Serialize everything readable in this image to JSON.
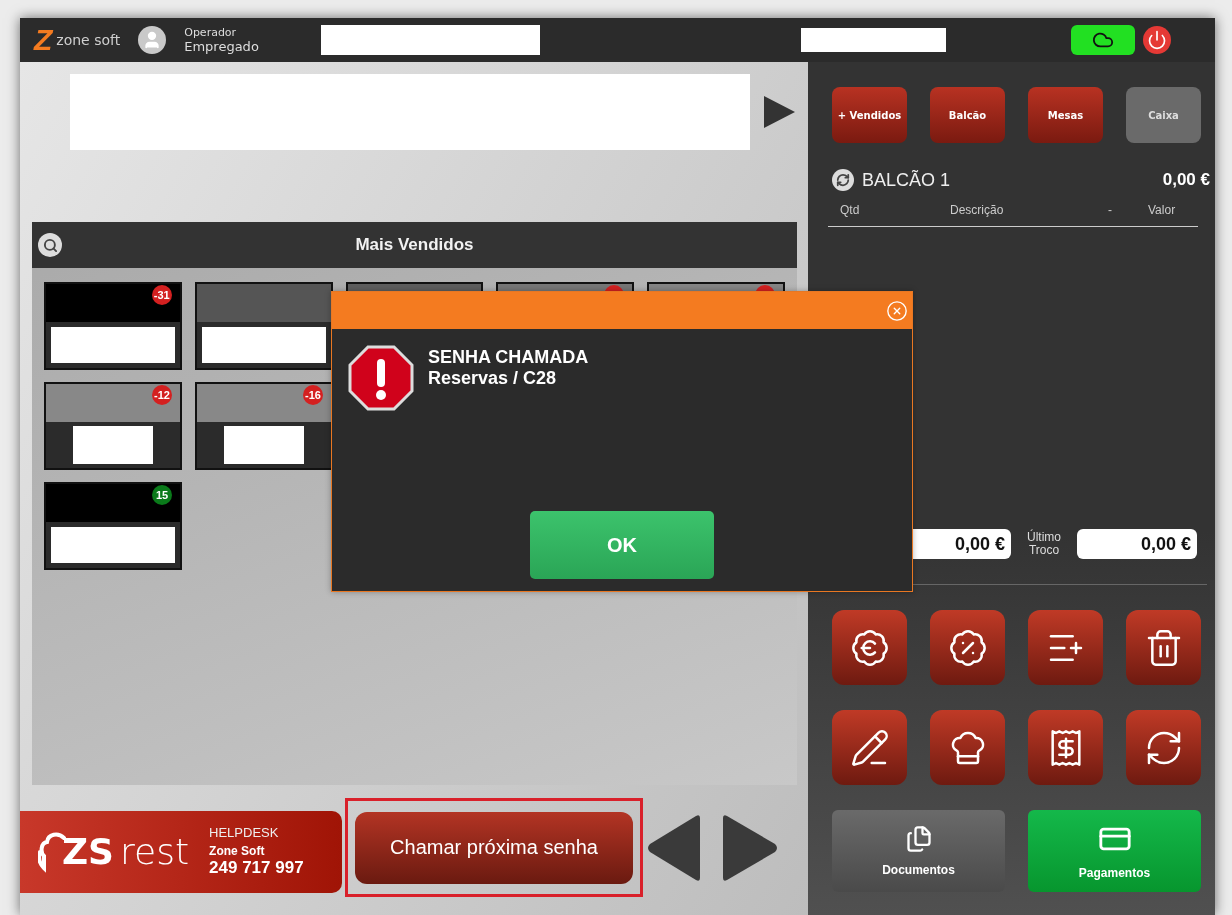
{
  "header": {
    "logo": {
      "mark": "Z",
      "name": "zone soft"
    },
    "operator": {
      "role": "Operador",
      "name": "Empregado"
    },
    "sync": {
      "online": true
    }
  },
  "products": {
    "title": "Mais Vendidos",
    "rows": [
      [
        {
          "color": "#000000",
          "badge": {
            "text": "-31",
            "color": "#d42020"
          }
        },
        {
          "color": "#555555"
        },
        {
          "color": "#5e5e5e"
        },
        {
          "color": "#777777",
          "badge": {
            "color": "#d42020"
          }
        },
        {
          "color": "#858585",
          "badge": {
            "color": "#d42020"
          }
        }
      ],
      [
        {
          "color": "#888888",
          "badge": {
            "text": "-12",
            "color": "#d42020"
          }
        },
        {
          "color": "#888888",
          "badge": {
            "text": "-16",
            "color": "#d42020"
          }
        }
      ],
      [
        {
          "color": "#000000",
          "badge": {
            "text": "15",
            "color": "#0a7a1a"
          }
        }
      ]
    ]
  },
  "nav": [
    {
      "label": "+ Vendidos",
      "disabled": false
    },
    {
      "label": "Balcão",
      "disabled": false
    },
    {
      "label": "Mesas",
      "disabled": false
    },
    {
      "label": "Caixa",
      "disabled": true
    }
  ],
  "order": {
    "title": "BALCÃO 1",
    "total": "0,00 €",
    "columns": [
      "Qtd",
      "Descrição",
      "-",
      "Valor"
    ]
  },
  "totals": {
    "field_1": "0,00 €",
    "label": "Último Troco",
    "field_2": "0,00 €"
  },
  "actions": [
    {
      "label": "Documentos",
      "kind": "documents"
    },
    {
      "label": "Pagamentos",
      "kind": "payments"
    }
  ],
  "footer": {
    "helpdesk": {
      "brand_mark": "ZS",
      "brand_word": "rest",
      "title": "HELPDESK",
      "company": "Zone Soft",
      "phone": "249 717 997"
    },
    "call_button": {
      "label": "Chamar próxima senha",
      "highlighted": true
    }
  },
  "dialog": {
    "lines": [
      "SENHA CHAMADA",
      "Reservas / C28"
    ],
    "button": "OK"
  }
}
